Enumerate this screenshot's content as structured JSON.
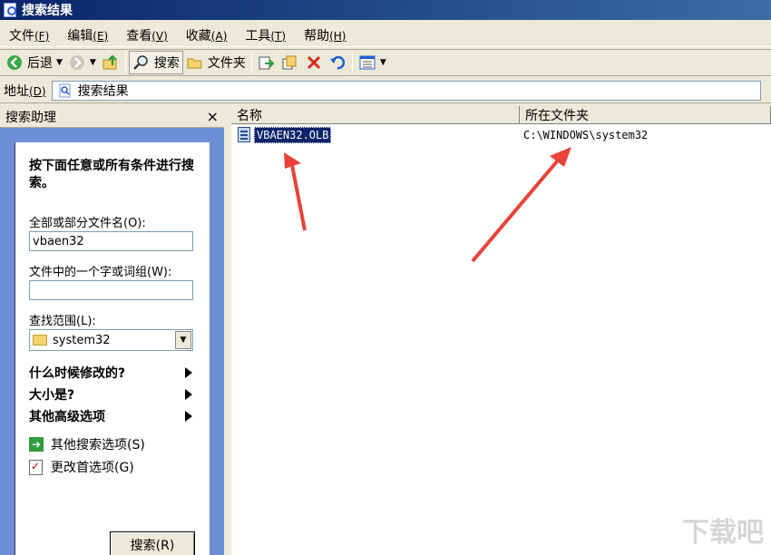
{
  "window": {
    "title": "搜索结果"
  },
  "menu": [
    {
      "label": "文件",
      "accel": "(F)"
    },
    {
      "label": "编辑",
      "accel": "(E)"
    },
    {
      "label": "查看",
      "accel": "(V)"
    },
    {
      "label": "收藏",
      "accel": "(A)"
    },
    {
      "label": "工具",
      "accel": "(T)"
    },
    {
      "label": "帮助",
      "accel": "(H)"
    }
  ],
  "toolbar": {
    "back_label": "后退",
    "search_label": "搜索",
    "folders_label": "文件夹"
  },
  "address": {
    "label": "地址",
    "accel": "(D)",
    "value": "搜索结果"
  },
  "sidepanel": {
    "title": "搜索助理",
    "close": "×",
    "prompt": "按下面任意或所有条件进行搜索。",
    "filename_label": "全部或部分文件名(O):",
    "filename_value": "vbaen32",
    "word_label": "文件中的一个字或词组(W):",
    "word_value": "",
    "lookin_label": "查找范围(L):",
    "lookin_value": "system32",
    "when_modified": "什么时候修改的?",
    "size": "大小是?",
    "advanced": "其他高级选项",
    "other_options": "其他搜索选项(S)",
    "change_prefs": "更改首选项(G)",
    "search_button": "搜索(R)"
  },
  "results": {
    "columns": [
      "名称",
      "所在文件夹"
    ],
    "rows": [
      {
        "name": "VBAEN32.OLB",
        "folder": "C:\\WINDOWS\\system32"
      }
    ]
  },
  "watermark": "下载吧",
  "colors": {
    "title_start": "#0a246a",
    "title_end": "#3a6ea5",
    "panel": "#6b8ed6",
    "selection": "#0a246a",
    "arrow": "#e8423a"
  }
}
